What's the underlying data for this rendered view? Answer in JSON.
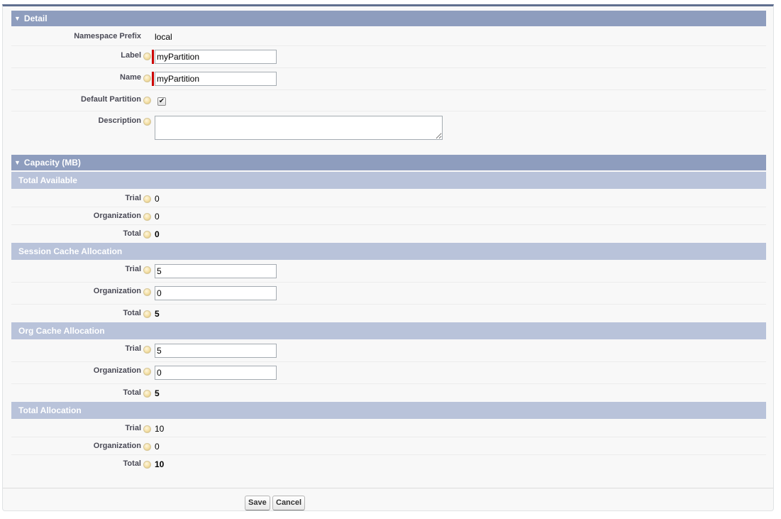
{
  "detail": {
    "header": "Detail",
    "namespace_prefix": {
      "label": "Namespace Prefix",
      "value": "local"
    },
    "label": {
      "label": "Label",
      "value": "myPartition"
    },
    "name": {
      "label": "Name",
      "value": "myPartition"
    },
    "default_partition": {
      "label": "Default Partition",
      "checked": true,
      "check_glyph": "✔"
    },
    "description": {
      "label": "Description",
      "value": ""
    }
  },
  "capacity": {
    "header": "Capacity (MB)",
    "total_available": {
      "header": "Total Available",
      "trial": {
        "label": "Trial",
        "value": "0"
      },
      "organization": {
        "label": "Organization",
        "value": "0"
      },
      "total": {
        "label": "Total",
        "value": "0"
      }
    },
    "session_cache": {
      "header": "Session Cache Allocation",
      "trial": {
        "label": "Trial",
        "value": "5"
      },
      "organization": {
        "label": "Organization",
        "value": "0"
      },
      "total": {
        "label": "Total",
        "value": "5"
      }
    },
    "org_cache": {
      "header": "Org Cache Allocation",
      "trial": {
        "label": "Trial",
        "value": "5"
      },
      "organization": {
        "label": "Organization",
        "value": "0"
      },
      "total": {
        "label": "Total",
        "value": "5"
      }
    },
    "total_allocation": {
      "header": "Total Allocation",
      "trial": {
        "label": "Trial",
        "value": "10"
      },
      "organization": {
        "label": "Organization",
        "value": "0"
      },
      "total": {
        "label": "Total",
        "value": "10"
      }
    }
  },
  "buttons": {
    "save": "Save",
    "cancel": "Cancel"
  },
  "icons": {
    "section_toggle": "triangle-down-icon",
    "help": "help-bubble-icon",
    "collapse_glyph": "▼"
  },
  "colors": {
    "section_header_bg": "#8e9dbe",
    "sub_header_bg": "#b9c3da",
    "required_marker": "#cc0000",
    "panel_bg": "#f8f8f8"
  }
}
